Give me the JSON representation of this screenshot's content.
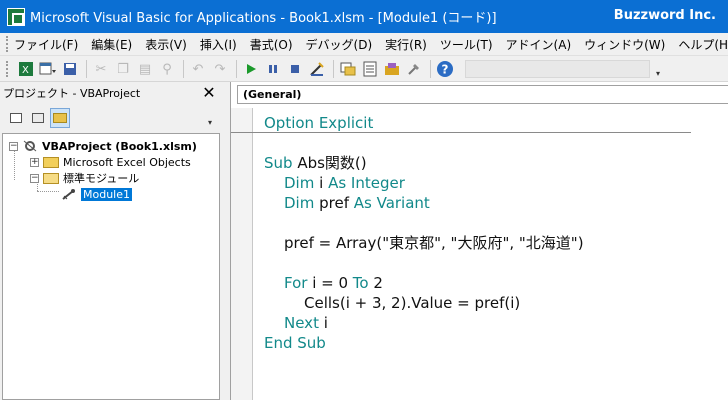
{
  "window": {
    "title": "Microsoft Visual Basic for Applications - Book1.xlsm - [Module1 (コード)]",
    "brand": "Buzzword Inc."
  },
  "menu": [
    "ファイル(F)",
    "編集(E)",
    "表示(V)",
    "挿入(I)",
    "書式(O)",
    "デバッグ(D)",
    "実行(R)",
    "ツール(T)",
    "アドイン(A)",
    "ウィンドウ(W)",
    "ヘルプ(H)"
  ],
  "toolbar": {
    "icons": [
      "excel-icon",
      "insert-module-icon",
      "save-icon",
      "cut-icon",
      "copy-icon",
      "paste-icon",
      "find-icon",
      "undo-icon",
      "redo-icon",
      "run-icon",
      "break-icon",
      "reset-icon",
      "design-mode-icon",
      "project-explorer-icon",
      "properties-icon",
      "object-browser-icon",
      "toolbox-icon",
      "help-icon"
    ]
  },
  "project": {
    "title": "プロジェクト - VBAProject",
    "close": "✕",
    "tree": {
      "root": "VBAProject (Book1.xlsm)",
      "excel_objects": "Microsoft Excel Objects",
      "std_modules": "標準モジュール",
      "module": "Module1"
    }
  },
  "code_window": {
    "object_combo": "(General)",
    "lines": {
      "l1_kw": "Option Explicit",
      "l3_kw": "Sub",
      "l3_rest": " Abs関数()",
      "l4_kw1": "Dim",
      "l4_mid": " i ",
      "l4_kw2": "As Integer",
      "l5_kw1": "Dim",
      "l5_mid": " pref ",
      "l5_kw2": "As Variant",
      "l7": "pref = Array(\"東京都\", \"大阪府\", \"北海道\")",
      "l9_kw1": "For",
      "l9_mid": " i = 0 ",
      "l9_kw2": "To",
      "l9_end": " 2",
      "l10": "Cells(i + 3, 2).Value = pref(i)",
      "l11_kw": "Next",
      "l11_rest": " i",
      "l12_kw": "End Sub"
    }
  }
}
